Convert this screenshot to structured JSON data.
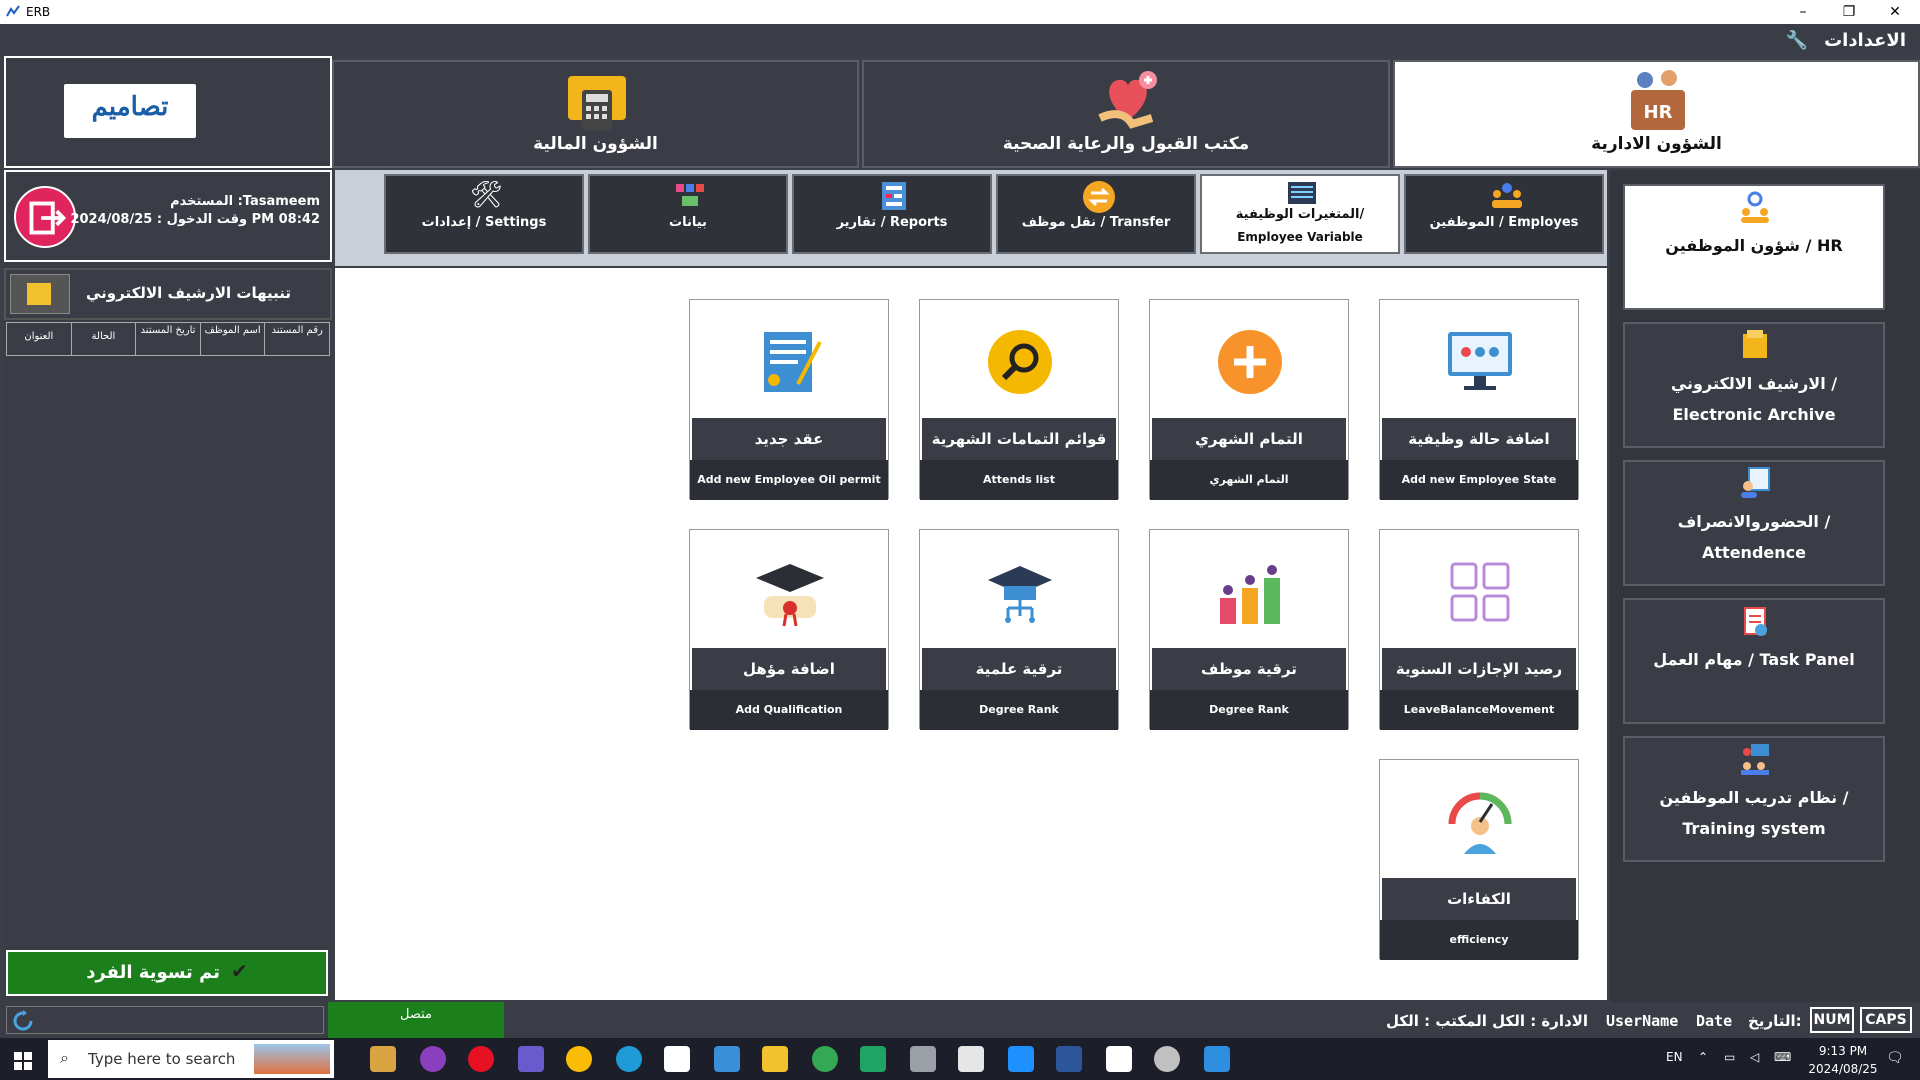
{
  "window": {
    "title": "ERB"
  },
  "header": {
    "title": "الاعدادات"
  },
  "modules": [
    {
      "label": "الشؤون الادارية",
      "active": true
    },
    {
      "label": "مكتب القبول والرعاية الصحية"
    },
    {
      "label": "الشؤون المالية"
    }
  ],
  "logo_text": "تصاميم",
  "user": {
    "user_line": "المستخدم :Tasameem",
    "login_line": "وقت الدخول : 2024/08/25 PM 08:42"
  },
  "alerts": {
    "title": "تنبيهات الارشيف الالكتروني",
    "columns": [
      "رقم المستند",
      "اسم الموظف",
      "تاريخ المستند",
      "الحالة",
      "العنوان"
    ]
  },
  "settle_button": "تم تسوية الفرد",
  "subtabs": [
    {
      "label": "الموظفين / Employes"
    },
    {
      "label": "المتغيرات الوظيفية/",
      "label2": "Employee Variable",
      "active": true
    },
    {
      "label": "نقل موظف / Transfer"
    },
    {
      "label": "تقارير / Reports"
    },
    {
      "label": "بيانات"
    },
    {
      "label": "إعدادات / Settings"
    }
  ],
  "tiles": [
    {
      "ar": "اضافة حالة وظيفية",
      "en": "Add new Employee State",
      "icon": "monitor-icon"
    },
    {
      "ar": "التمام الشهري",
      "en": "التمام الشهري",
      "icon": "plus-circle-icon"
    },
    {
      "ar": "قوائم التمامات الشهرية",
      "en": "Attends list",
      "icon": "magnifier-icon"
    },
    {
      "ar": "عقد جديد",
      "en": "Add new Employee Oil permit",
      "icon": "contract-icon"
    },
    {
      "ar": "رصيد الإجازات السنوية",
      "en": "LeaveBalanceMovement",
      "icon": "leave-grid-icon"
    },
    {
      "ar": "ترقية موظف",
      "en": "Degree Rank",
      "icon": "promotion-bars-icon"
    },
    {
      "ar": "ترقية علمية",
      "en": "Degree Rank",
      "icon": "grad-cap-network-icon"
    },
    {
      "ar": "اضافة مؤهل",
      "en": "Add Qualification",
      "icon": "diploma-icon"
    },
    {
      "ar": "الكفاءات",
      "en": "efficiency",
      "icon": "gauge-person-icon"
    }
  ],
  "side": [
    {
      "label": "شؤون الموظفين / HR",
      "active": true
    },
    {
      "label": "الارشيف الالكتروني / Electronic Archive"
    },
    {
      "label": "الحضوروالانصراف / Attendence"
    },
    {
      "label": "مهام العمل / Task Panel"
    },
    {
      "label": "نظام تدريب الموظفين / Training system"
    }
  ],
  "status": {
    "connected": "متصل",
    "office": "الادارة : الكل المكتب : الكل",
    "username": "UserName",
    "date_label": "Date",
    "date_ar": "التاريخ:",
    "num": "NUM",
    "caps": "CAPS"
  },
  "taskbar": {
    "search": "Type here to search",
    "lang": "EN",
    "time": "9:13 PM",
    "date": "2024/08/25"
  }
}
